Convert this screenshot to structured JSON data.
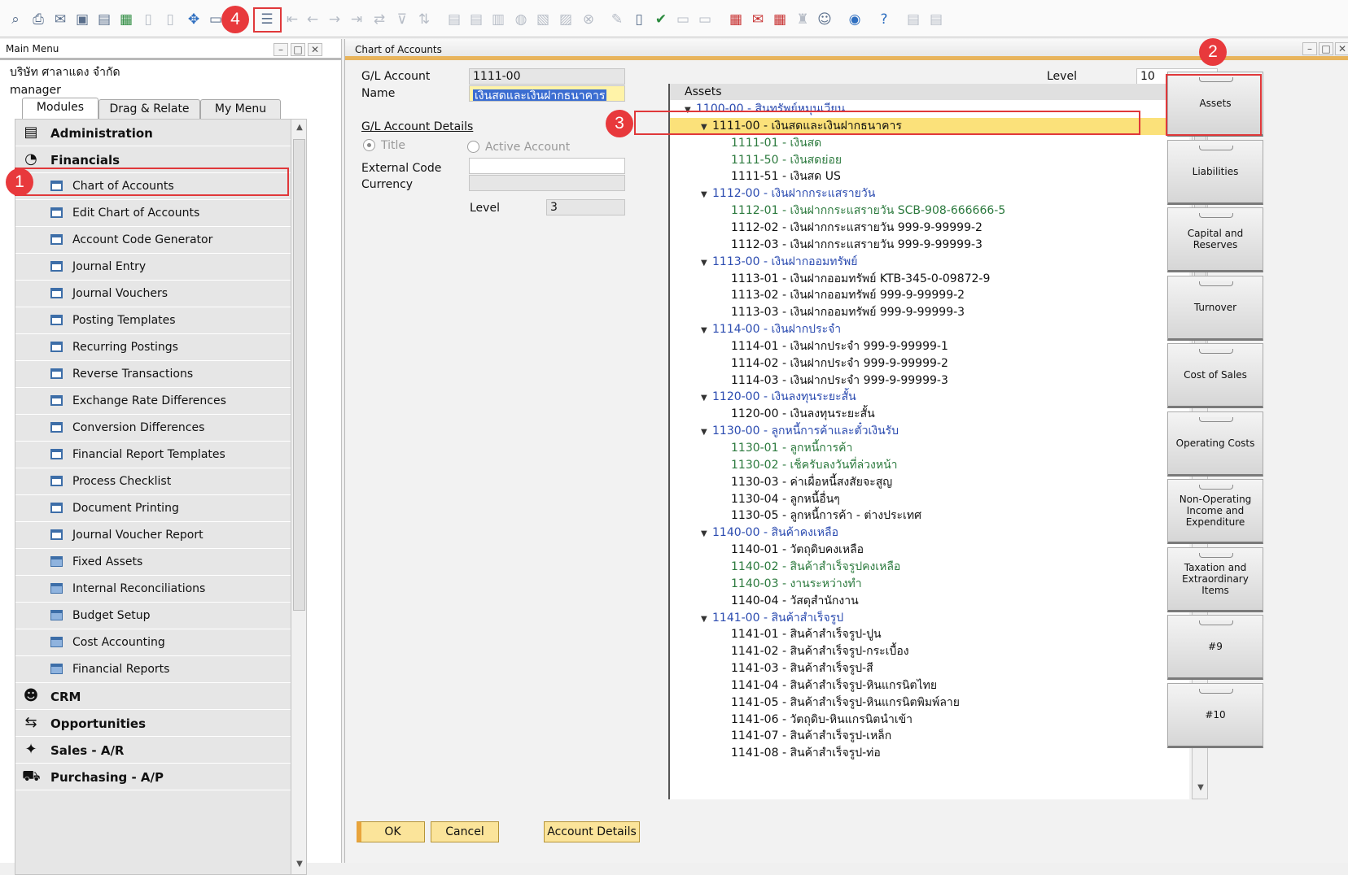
{
  "main_menu": {
    "title": "Main Menu",
    "company": "บริษัท ศาลาแดง จำกัด",
    "user": "manager",
    "tabs": [
      "Modules",
      "Drag & Relate",
      "My Menu"
    ],
    "items": [
      {
        "label": "Administration",
        "kind": "module"
      },
      {
        "label": "Financials",
        "kind": "module"
      },
      {
        "label": "Chart of Accounts",
        "kind": "doc"
      },
      {
        "label": "Edit Chart of Accounts",
        "kind": "doc"
      },
      {
        "label": "Account Code Generator",
        "kind": "doc"
      },
      {
        "label": "Journal Entry",
        "kind": "doc"
      },
      {
        "label": "Journal Vouchers",
        "kind": "doc"
      },
      {
        "label": "Posting Templates",
        "kind": "doc"
      },
      {
        "label": "Recurring Postings",
        "kind": "doc"
      },
      {
        "label": "Reverse Transactions",
        "kind": "doc"
      },
      {
        "label": "Exchange Rate Differences",
        "kind": "doc"
      },
      {
        "label": "Conversion Differences",
        "kind": "doc"
      },
      {
        "label": "Financial Report Templates",
        "kind": "doc"
      },
      {
        "label": "Process Checklist",
        "kind": "doc"
      },
      {
        "label": "Document Printing",
        "kind": "doc"
      },
      {
        "label": "Journal Voucher Report",
        "kind": "doc"
      },
      {
        "label": "Fixed Assets",
        "kind": "folder"
      },
      {
        "label": "Internal Reconciliations",
        "kind": "folder"
      },
      {
        "label": "Budget Setup",
        "kind": "folder"
      },
      {
        "label": "Cost Accounting",
        "kind": "folder"
      },
      {
        "label": "Financial Reports",
        "kind": "folder"
      },
      {
        "label": "CRM",
        "kind": "module"
      },
      {
        "label": "Opportunities",
        "kind": "module"
      },
      {
        "label": "Sales - A/R",
        "kind": "module"
      },
      {
        "label": "Purchasing - A/P",
        "kind": "module"
      }
    ]
  },
  "coa": {
    "title": "Chart of Accounts",
    "gl_account_label": "G/L Account",
    "gl_account_value": "1111-00",
    "name_label": "Name",
    "name_value": "เงินสดและเงินฝากธนาคาร",
    "details_label": "G/L Account Details",
    "title_radio": "Title",
    "active_radio": "Active Account",
    "external_code_label": "External Code",
    "currency_label": "Currency",
    "level_label": "Level",
    "level_value": "3",
    "top_level_label": "Level",
    "top_level_value": "10",
    "tree_header": "Assets",
    "tree": [
      {
        "t": "1100-00 - สินทรัพย์หมุนเวียน",
        "d": 0,
        "k": "title"
      },
      {
        "t": "1111-00 - เงินสดและเงินฝากธนาคาร",
        "d": 1,
        "k": "selected"
      },
      {
        "t": "1111-01 - เงินสด",
        "d": 2,
        "k": "green"
      },
      {
        "t": "1111-50 - เงินสดย่อย",
        "d": 2,
        "k": "green"
      },
      {
        "t": "1111-51 - เงินสด US",
        "d": 2,
        "k": "black"
      },
      {
        "t": "1112-00 - เงินฝากกระแสรายวัน",
        "d": 1,
        "k": "title"
      },
      {
        "t": "1112-01 - เงินฝากกระแสรายวัน SCB-908-666666-5",
        "d": 2,
        "k": "green"
      },
      {
        "t": "1112-02 - เงินฝากกระแสรายวัน 999-9-99999-2",
        "d": 2,
        "k": "black"
      },
      {
        "t": "1112-03 - เงินฝากกระแสรายวัน 999-9-99999-3",
        "d": 2,
        "k": "black"
      },
      {
        "t": "1113-00 - เงินฝากออมทรัพย์",
        "d": 1,
        "k": "title"
      },
      {
        "t": "1113-01 - เงินฝากออมทรัพย์ KTB-345-0-09872-9",
        "d": 2,
        "k": "black"
      },
      {
        "t": "1113-02 - เงินฝากออมทรัพย์ 999-9-99999-2",
        "d": 2,
        "k": "black"
      },
      {
        "t": "1113-03 - เงินฝากออมทรัพย์ 999-9-99999-3",
        "d": 2,
        "k": "black"
      },
      {
        "t": "1114-00 - เงินฝากประจำ",
        "d": 1,
        "k": "title"
      },
      {
        "t": "1114-01 - เงินฝากประจำ 999-9-99999-1",
        "d": 2,
        "k": "black"
      },
      {
        "t": "1114-02 - เงินฝากประจำ 999-9-99999-2",
        "d": 2,
        "k": "black"
      },
      {
        "t": "1114-03 - เงินฝากประจำ 999-9-99999-3",
        "d": 2,
        "k": "black"
      },
      {
        "t": "1120-00 - เงินลงทุนระยะสั้น",
        "d": 1,
        "k": "title"
      },
      {
        "t": "1120-00 - เงินลงทุนระยะสั้น",
        "d": 2,
        "k": "black"
      },
      {
        "t": "1130-00 - ลูกหนี้การค้าและตั๋วเงินรับ",
        "d": 1,
        "k": "title"
      },
      {
        "t": "1130-01 - ลูกหนี้การค้า",
        "d": 2,
        "k": "green"
      },
      {
        "t": "1130-02 - เช็ครับลงวันที่ล่วงหน้า",
        "d": 2,
        "k": "green"
      },
      {
        "t": "1130-03 - ค่าเผื่อหนี้สงสัยจะสูญ",
        "d": 2,
        "k": "black"
      },
      {
        "t": "1130-04 - ลูกหนี้อื่นๆ",
        "d": 2,
        "k": "black"
      },
      {
        "t": "1130-05 - ลูกหนี้การค้า - ต่างประเทศ",
        "d": 2,
        "k": "black"
      },
      {
        "t": "1140-00 - สินค้าคงเหลือ",
        "d": 1,
        "k": "title"
      },
      {
        "t": "1140-01 - วัตถุดิบคงเหลือ",
        "d": 2,
        "k": "black"
      },
      {
        "t": "1140-02 - สินค้าสำเร็จรูปคงเหลือ",
        "d": 2,
        "k": "green"
      },
      {
        "t": "1140-03 - งานระหว่างทำ",
        "d": 2,
        "k": "green"
      },
      {
        "t": "1140-04 - วัสดุสำนักงาน",
        "d": 2,
        "k": "black"
      },
      {
        "t": "1141-00 - สินค้าสำเร็จรูป",
        "d": 1,
        "k": "title"
      },
      {
        "t": "1141-01 - สินค้าสำเร็จรูป-ปูน",
        "d": 2,
        "k": "black"
      },
      {
        "t": "1141-02 - สินค้าสำเร็จรูป-กระเบื้อง",
        "d": 2,
        "k": "black"
      },
      {
        "t": "1141-03 - สินค้าสำเร็จรูป-สี",
        "d": 2,
        "k": "black"
      },
      {
        "t": "1141-04 - สินค้าสำเร็จรูป-หินแกรนิตไทย",
        "d": 2,
        "k": "black"
      },
      {
        "t": "1141-05 - สินค้าสำเร็จรูป-หินแกรนิตพิมพ์ลาย",
        "d": 2,
        "k": "black"
      },
      {
        "t": "1141-06 - วัตถุดิบ-หินแกรนิตนำเข้า",
        "d": 2,
        "k": "black"
      },
      {
        "t": "1141-07 - สินค้าสำเร็จรูป-เหล็ก",
        "d": 2,
        "k": "black"
      },
      {
        "t": "1141-08 - สินค้าสำเร็จรูป-ท่อ",
        "d": 2,
        "k": "black"
      }
    ],
    "drawers": [
      "Assets",
      "Liabilities",
      "Capital and Reserves",
      "Turnover",
      "Cost of Sales",
      "Operating Costs",
      "Non-Operating Income and Expenditure",
      "Taxation and Extraordinary Items",
      "#9",
      "#10"
    ],
    "buttons": {
      "ok": "OK",
      "cancel": "Cancel",
      "account_details": "Account Details"
    }
  },
  "annotations": [
    "1",
    "2",
    "3",
    "4"
  ],
  "colors": {
    "accent": "#e8393c",
    "title_account": "#2b4bb0",
    "active_account": "#2c7a3e",
    "selected_row": "#fbe17a",
    "button": "#fbe49a"
  }
}
